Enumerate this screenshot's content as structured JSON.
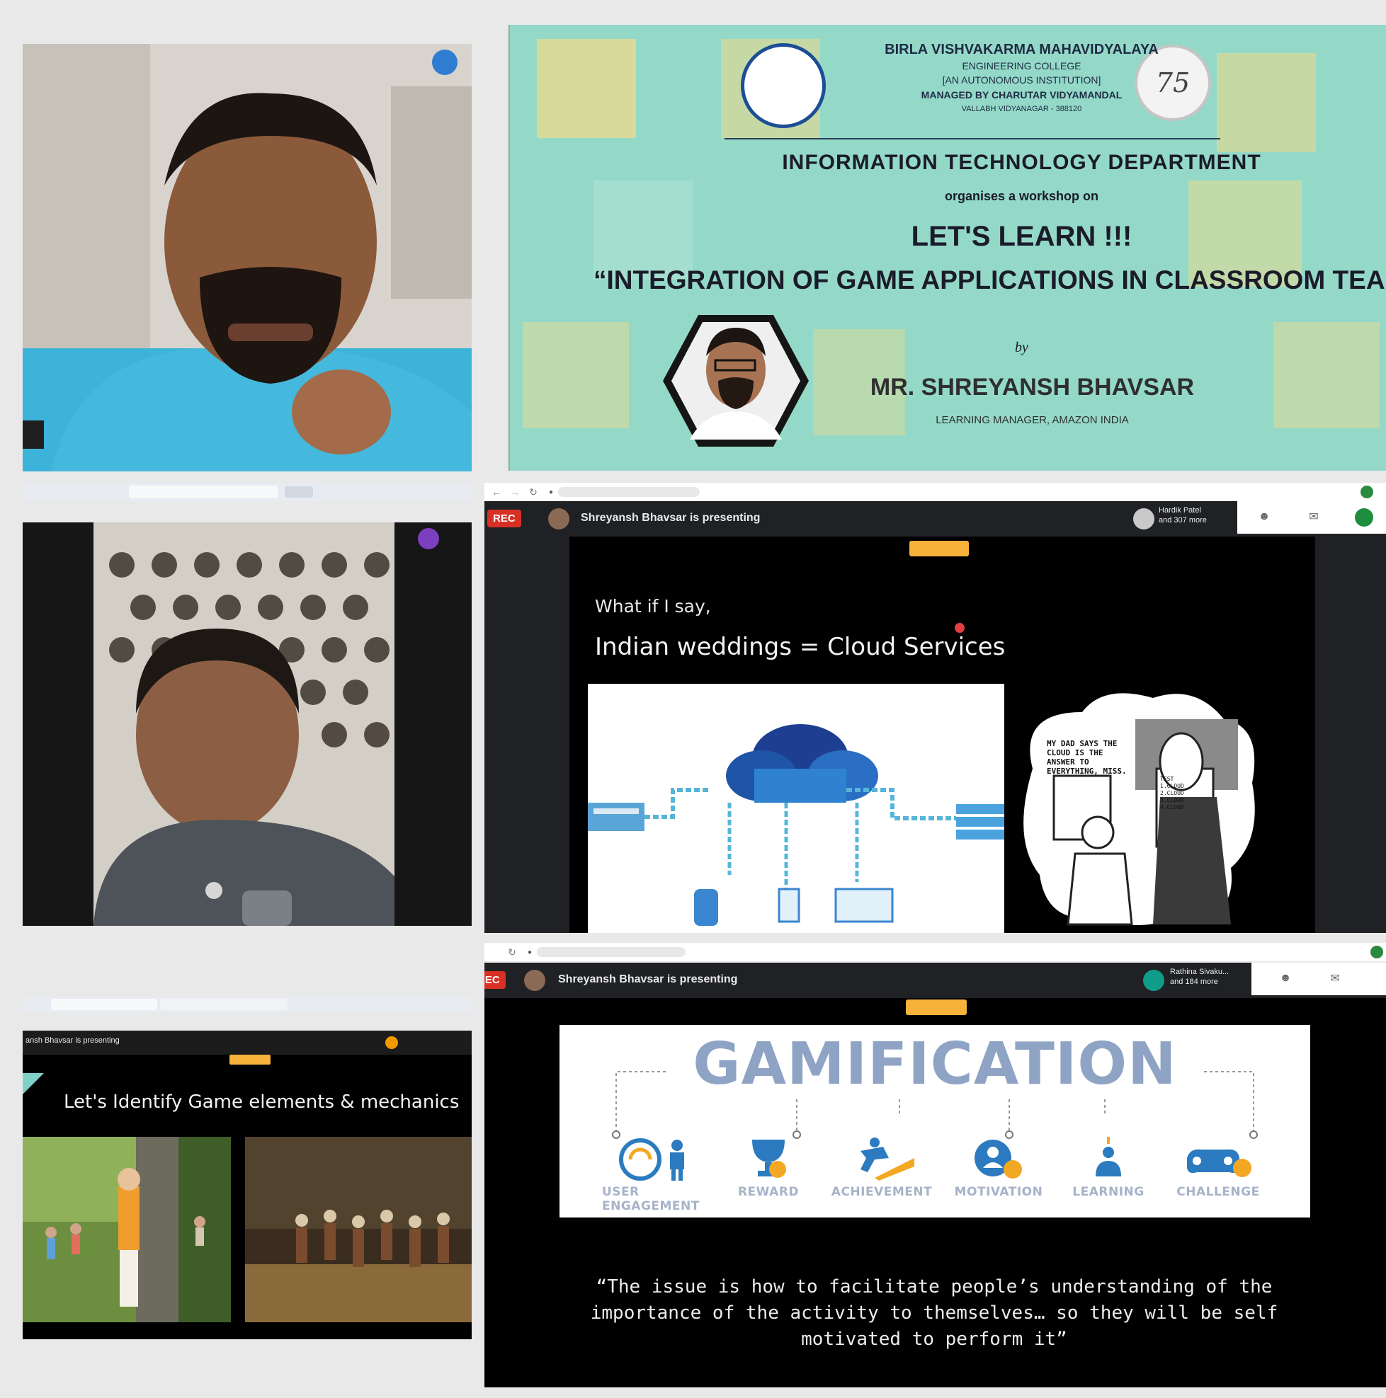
{
  "poster": {
    "institution": "BIRLA VISHVAKARMA MAHAVIDYALAYA",
    "college": "ENGINEERING COLLEGE",
    "autonomous": "[AN AUTONOMOUS INSTITUTION]",
    "managed_by": "MANAGED BY CHARUTAR VIDYAMANDAL",
    "location": "VALLABH VIDYANAGAR - 388120",
    "department": "INFORMATION TECHNOLOGY DEPARTMENT",
    "organises": "organises a workshop on",
    "lets_learn": "LET'S LEARN !!!",
    "workshop_title": "“INTEGRATION OF GAME APPLICATIONS IN CLASSROOM TEACHING”",
    "by": "by",
    "speaker": "MR. SHREYANSH BHAVSAR",
    "speaker_role": "LEARNING MANAGER, AMAZON INDIA",
    "badge_number": "75"
  },
  "meet_mid": {
    "rec_label": "REC",
    "presenting": "Shreyansh Bhavsar is presenting",
    "participants": "Hardik Patel\nand 307 more",
    "slide": {
      "line1": "What if I say,",
      "line2": "Indian weddings = Cloud Services",
      "cartoon_bubble": "MY DAD SAYS THE CLOUD IS THE ANSWER TO EVERYTHING, MISS.",
      "cartoon_sign": "TEST\n1.CLOUD\n2.CLOUD\n3.CLOUD\n4.CLOUD"
    }
  },
  "meet_bottom": {
    "rec_label": "REC",
    "presenting": "Shreyansh Bhavsar is presenting",
    "participants": "Rathina Sivaku...\nand 184 more",
    "slide": {
      "heading": "GAMIFICATION",
      "items": [
        {
          "icon": "user-engagement-icon",
          "label": "USER ENGAGEMENT"
        },
        {
          "icon": "reward-icon",
          "label": "REWARD"
        },
        {
          "icon": "achievement-icon",
          "label": "ACHIEVEMENT"
        },
        {
          "icon": "motivation-icon",
          "label": "MOTIVATION"
        },
        {
          "icon": "learning-icon",
          "label": "LEARNING"
        },
        {
          "icon": "challenge-icon",
          "label": "CHALLENGE"
        }
      ],
      "quote": "“The issue is how to facilitate people’s understanding of the importance of the activity to themselves… so they will be self motivated to perform it”"
    }
  },
  "meet_small": {
    "presenting": "ansh Bhavsar is presenting",
    "slide_title": "Let's Identify Game elements & mechanics"
  },
  "colors": {
    "poster_bg": "#8fd7c6",
    "poster_yellow": "#e9d98d",
    "rec_red": "#d93025",
    "gamification_blue": "#8fa4c4",
    "icon_orange": "#f2a823",
    "icon_blue": "#2c7bc0"
  }
}
